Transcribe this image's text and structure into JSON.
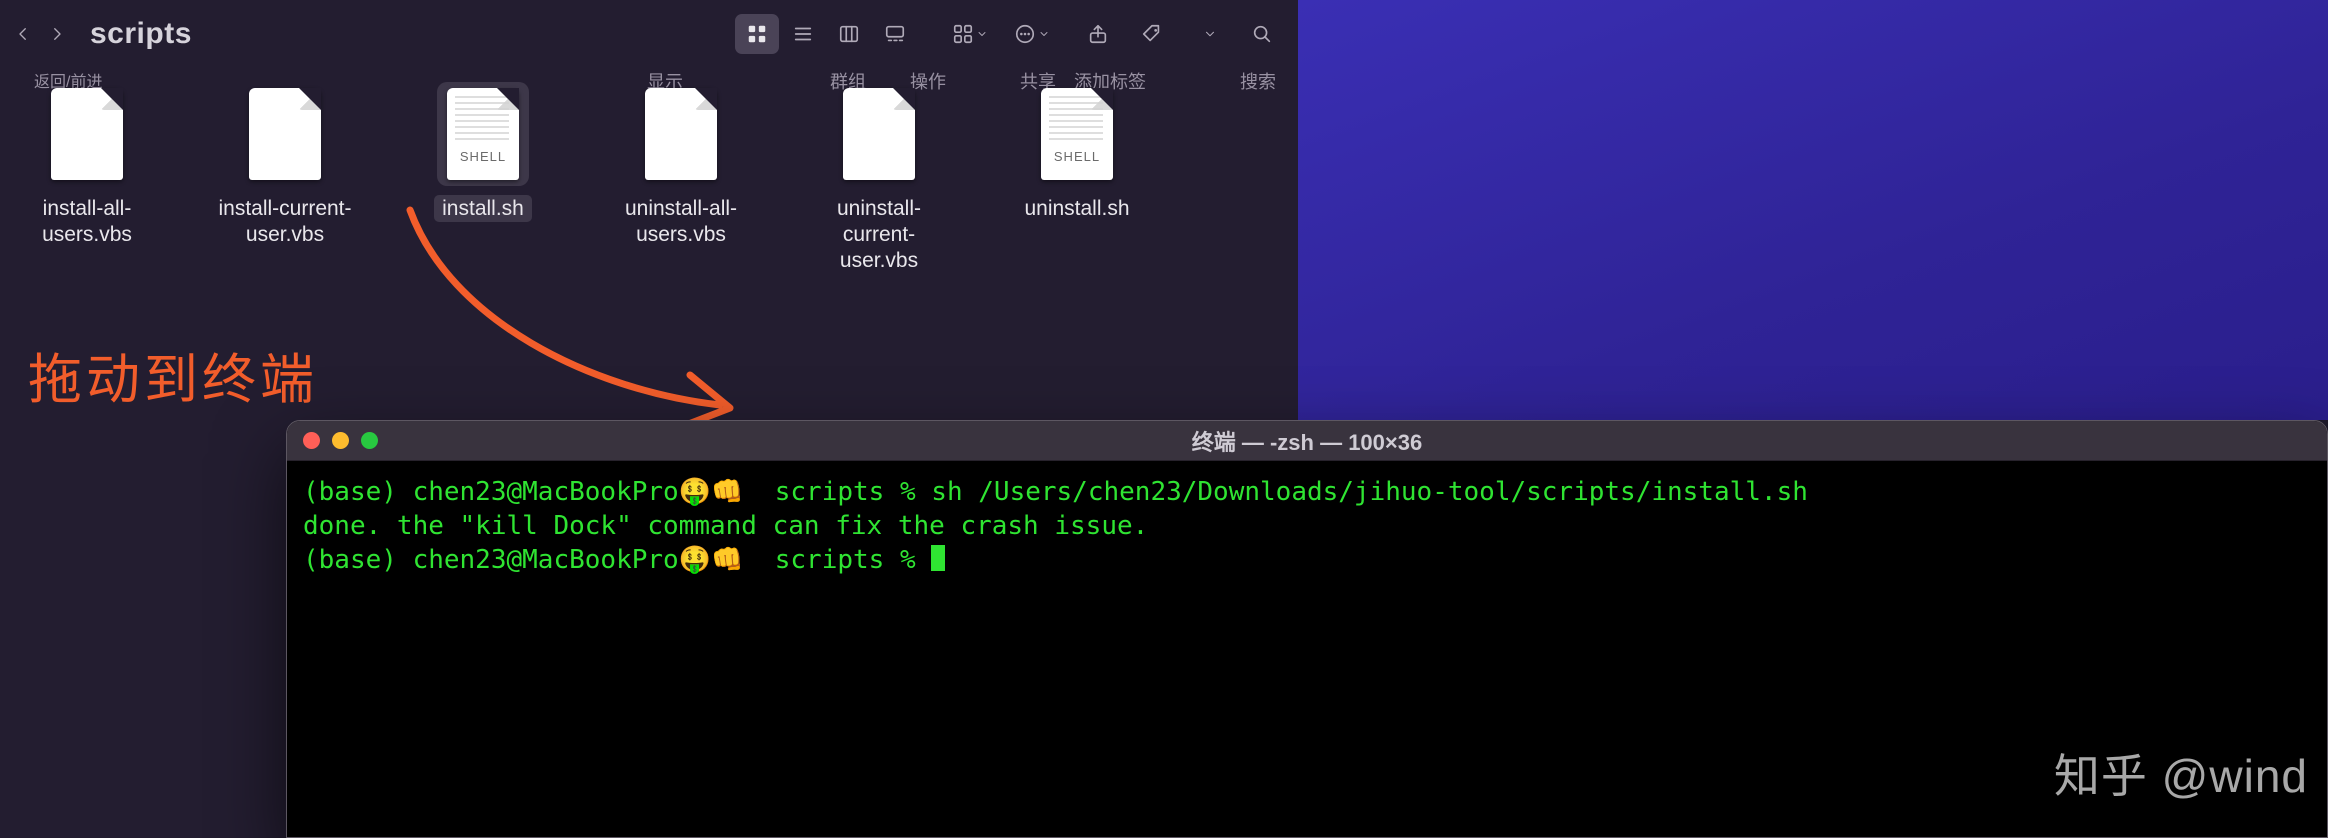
{
  "finder": {
    "folder_title": "scripts",
    "nav_back_forward_label": "返回/前进",
    "toolbar_labels": {
      "display": "显示",
      "group": "群组",
      "action": "操作",
      "share": "共享",
      "tags": "添加标签",
      "search": "搜索"
    },
    "files": [
      {
        "name": "install-all-users.vbs",
        "kind": "plain",
        "selected": false
      },
      {
        "name": "install-current-user.vbs",
        "kind": "plain",
        "selected": false
      },
      {
        "name": "install.sh",
        "kind": "shell",
        "selected": true,
        "badge": "SHELL"
      },
      {
        "name": "uninstall-all-users.vbs",
        "kind": "plain",
        "selected": false
      },
      {
        "name": "uninstall-current-user.vbs",
        "kind": "plain",
        "selected": false
      },
      {
        "name": "uninstall.sh",
        "kind": "shell",
        "selected": false,
        "badge": "SHELL"
      }
    ]
  },
  "annotation": {
    "text": "拖动到终端"
  },
  "terminal": {
    "title": "终端 — -zsh — 100×36",
    "prompt_prefix": "(base) chen23@MacBookPro",
    "prompt_emoji": "🤑👊",
    "prompt_dir": "scripts",
    "prompt_symbol": "%",
    "command": "sh /Users/chen23/Downloads/jihuo-tool/scripts/install.sh",
    "output_line": "done. the \"kill Dock\" command can fix the crash issue."
  },
  "watermark": "知乎 @wind"
}
